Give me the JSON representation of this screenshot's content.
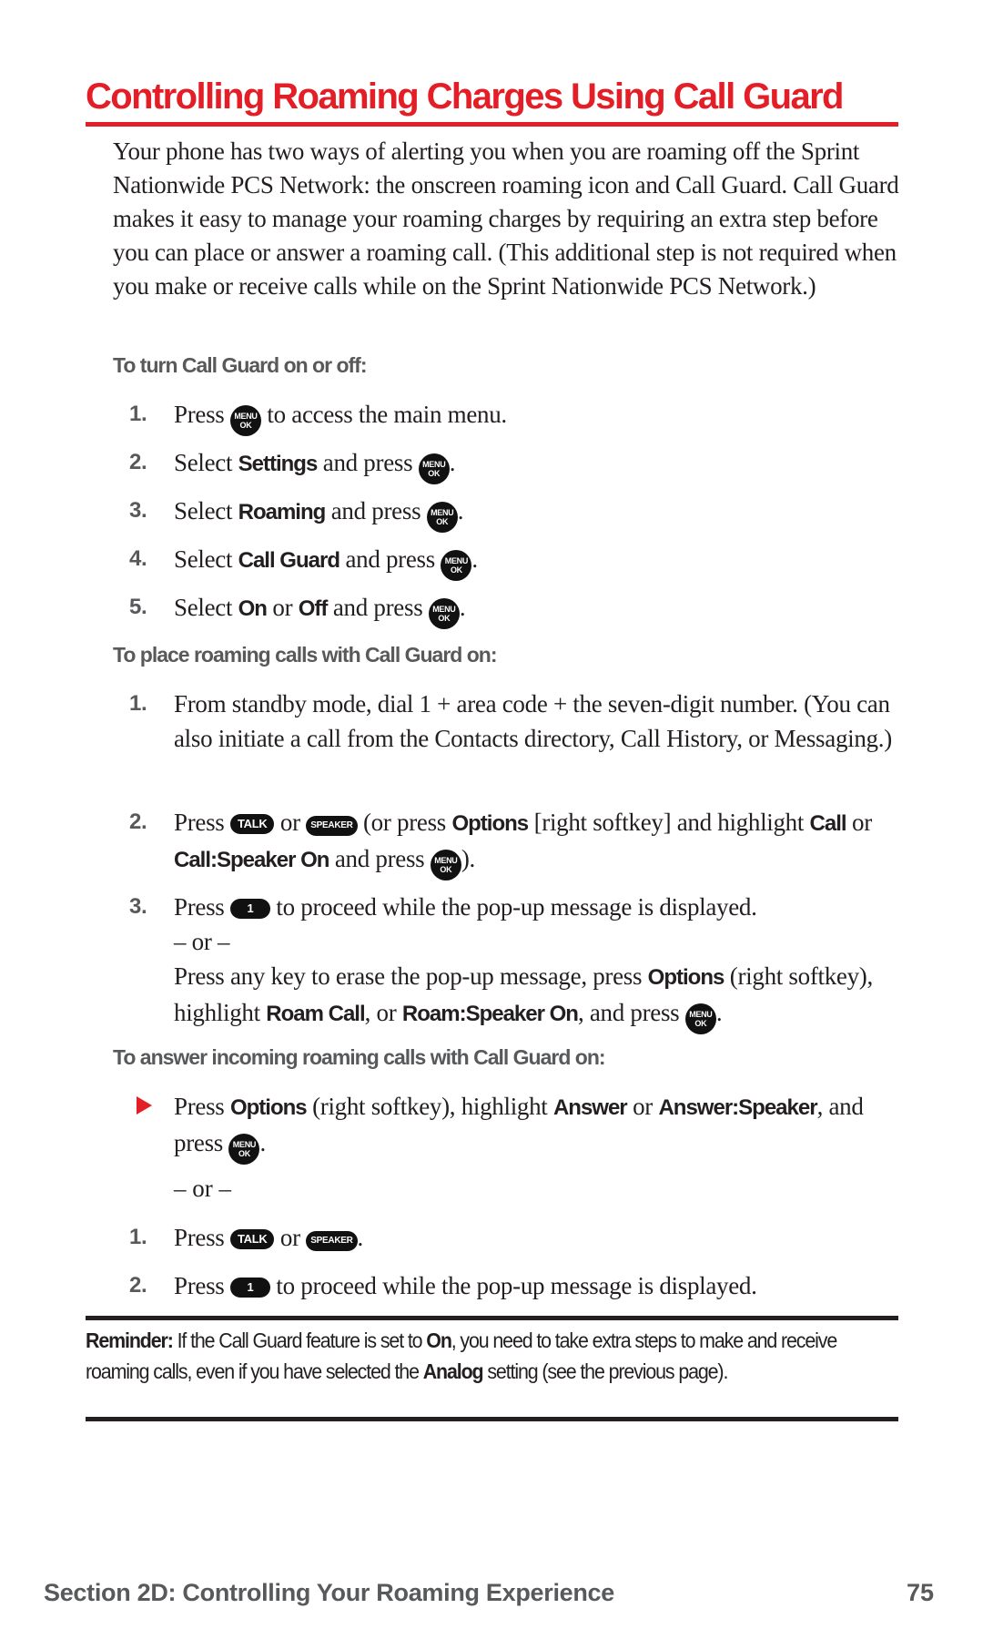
{
  "title": "Controlling Roaming Charges Using Call Guard",
  "intro": "Your phone has two ways of alerting you when you are roaming off the Sprint Nationwide PCS Network: the onscreen roaming icon and Call Guard. Call Guard makes it easy to manage your roaming charges by requiring an extra step before you can place or answer a roaming call. (This additional step is not required when you make or receive calls while on the Sprint Nationwide PCS Network.)",
  "keys": {
    "menu_top": "MENU",
    "menu_bottom": "OK",
    "talk": "TALK",
    "speaker": "SPEAKER",
    "one": "1"
  },
  "section1": {
    "heading": "To turn Call Guard on or off:",
    "steps": [
      {
        "num": "1.",
        "a": "Press",
        "b": "to access the main menu."
      },
      {
        "num": "2.",
        "a": "Select",
        "bold": "Settings",
        "b": "and press"
      },
      {
        "num": "3.",
        "a": "Select",
        "bold": "Roaming",
        "b": "and press"
      },
      {
        "num": "4.",
        "a": "Select",
        "bold": "Call Guard",
        "b": "and press"
      },
      {
        "num": "5.",
        "a": "Select",
        "bold": "On",
        "mid": "or",
        "bold2": "Off",
        "b": "and press"
      }
    ]
  },
  "section2": {
    "heading": "To place roaming calls with Call Guard on:",
    "steps": [
      {
        "num": "1.",
        "text": "From standby mode, dial 1 + area code + the seven-digit number. (You can also initiate a call from the Contacts directory, Call History, or Messaging.)"
      },
      {
        "num": "2.",
        "a": "Press",
        "or": "or",
        "c": "(or press",
        "bold1": "Options",
        "d": "[right softkey] and highlight",
        "bold2": "Call",
        "e": "or",
        "bold3": "Call:Speaker On",
        "f": "and press",
        "g": ")."
      },
      {
        "num": "3.",
        "a": "Press",
        "b": "to proceed while the pop-up message is displayed.",
        "or": "– or –",
        "c": "Press any key to erase the pop-up message, press",
        "bold1": "Options",
        "d": "(right softkey), highlight",
        "bold2": "Roam Call",
        "e": ", or",
        "bold3": "Roam:Speaker On",
        "f": ", and press"
      }
    ]
  },
  "section3": {
    "heading": "To answer incoming roaming calls with Call Guard on:",
    "bullet": {
      "a": "Press",
      "bold1": "Options",
      "b": "(right softkey), highlight",
      "bold2": "Answer",
      "c": "or",
      "bold3": "Answer:Speaker",
      "d": ", and press"
    },
    "or": "– or –",
    "steps": [
      {
        "num": "1.",
        "a": "Press",
        "or": "or"
      },
      {
        "num": "2.",
        "a": "Press",
        "b": "to proceed while the pop-up message is displayed."
      }
    ]
  },
  "reminder": {
    "label": "Reminder:",
    "a": "If the Call Guard feature is set to",
    "bold1": "On",
    "b": ", you need to take extra steps to make and receive roaming calls, even if you have selected the",
    "bold2": "Analog",
    "c": "setting (see the previous page)."
  },
  "footer": {
    "section": "Section 2D: Controlling Your Roaming Experience",
    "page": "75"
  },
  "colors": {
    "accent": "#e31e26",
    "heading_gray": "#58595b",
    "text": "#231f20"
  }
}
